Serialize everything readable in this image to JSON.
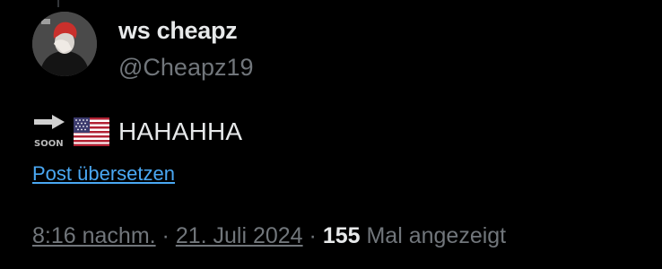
{
  "author": {
    "display_name": "ws cheapz",
    "handle": "@Cheapz19"
  },
  "tweet": {
    "emojis": [
      "soon-arrow-emoji",
      "us-flag-emoji"
    ],
    "text": "HAHAHHA",
    "translate_link": "Post übersetzen"
  },
  "meta": {
    "time": "8:16 nachm.",
    "separator_1": " · ",
    "date": "21. Juli 2024",
    "separator_2": " · ",
    "views_count": "155",
    "views_label": " Mal angezeigt"
  },
  "colors": {
    "background": "#000000",
    "primary_text": "#e7e9ea",
    "secondary_text": "#71767b",
    "link": "#4aa8f3"
  }
}
